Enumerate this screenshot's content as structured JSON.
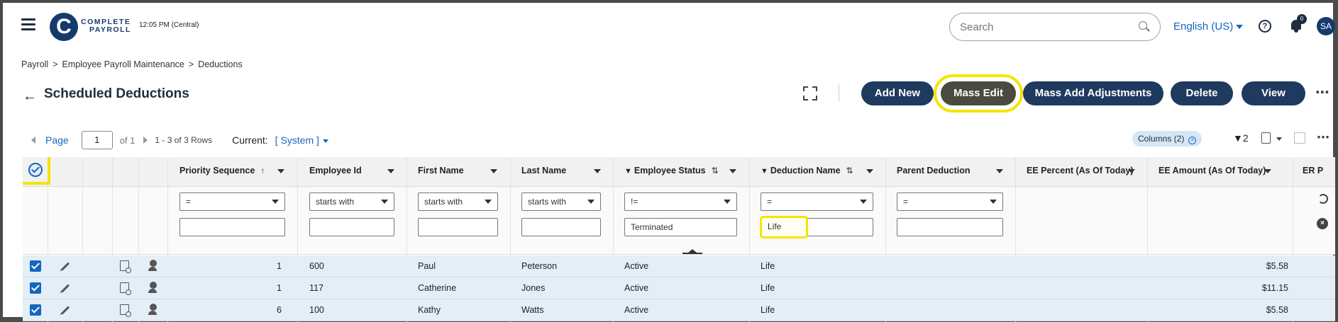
{
  "topbar": {
    "logo_letter": "C",
    "logo_line1": "COMPLETE",
    "logo_line2": "PAYROLL",
    "time": "12:05 PM (Central)",
    "search_placeholder": "Search",
    "language": "English (US)",
    "notifications_count": "0",
    "user_initials": "SA"
  },
  "breadcrumb": [
    "Payroll",
    "Employee Payroll Maintenance",
    "Deductions"
  ],
  "breadcrumb_sep": ">",
  "page": {
    "title": "Scheduled Deductions",
    "buttons": {
      "add_new": "Add New",
      "mass_edit": "Mass Edit",
      "mass_add_adjustments": "Mass Add Adjustments",
      "delete": "Delete",
      "view": "View"
    }
  },
  "pager": {
    "page_label": "Page",
    "page_value": "1",
    "of_label": "of 1",
    "rows_text": "1 - 3 of 3 Rows",
    "current_label": "Current:",
    "current_view": "[ System ]",
    "columns_chip": "Columns (2)",
    "filter_count": "2"
  },
  "columns": {
    "priority": "Priority Sequence",
    "employee_id": "Employee Id",
    "first_name": "First Name",
    "last_name": "Last Name",
    "employee_status": "Employee Status",
    "deduction_name": "Deduction Name",
    "parent_deduction": "Parent Deduction",
    "ee_percent": "EE Percent (As Of Today)",
    "ee_amount": "EE Amount (As Of Today)",
    "er_partial": "ER P"
  },
  "filters": {
    "priority_op": "=",
    "employee_id_op": "starts with",
    "first_name_op": "starts with",
    "last_name_op": "starts with",
    "employee_status_op": "!=",
    "employee_status_value": "Terminated",
    "deduction_name_op": "=",
    "deduction_name_value": "Life",
    "parent_deduction_op": "="
  },
  "rows": [
    {
      "priority": "1",
      "employee_id": "600",
      "first_name": "Paul",
      "last_name": "Peterson",
      "status": "Active",
      "deduction": "Life",
      "ee_amount": "$5.58"
    },
    {
      "priority": "1",
      "employee_id": "117",
      "first_name": "Catherine",
      "last_name": "Jones",
      "status": "Active",
      "deduction": "Life",
      "ee_amount": "$11.15"
    },
    {
      "priority": "6",
      "employee_id": "100",
      "first_name": "Kathy",
      "last_name": "Watts",
      "status": "Active",
      "deduction": "Life",
      "ee_amount": "$5.58"
    }
  ],
  "colors": {
    "primary_button": "#1e3a5f",
    "highlight": "#f5e400",
    "link": "#1565c0",
    "row_selected": "#e4eef7"
  }
}
